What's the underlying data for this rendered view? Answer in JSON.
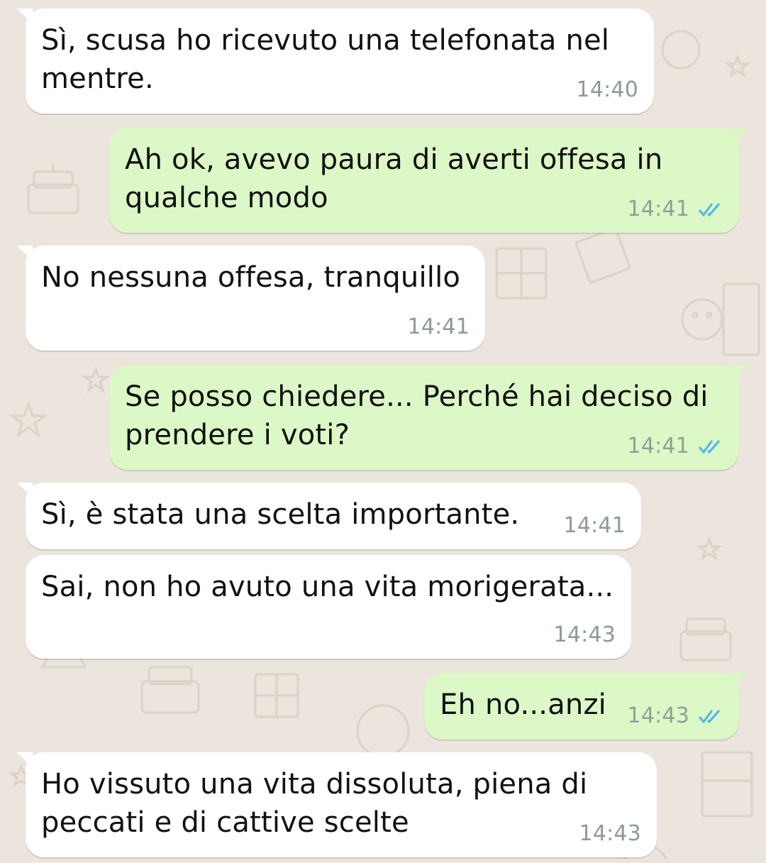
{
  "colors": {
    "background": "#ece5dd",
    "incoming_bubble": "#ffffff",
    "outgoing_bubble": "#dcf8c6",
    "read_ticks": "#4fb6ec",
    "timestamp": "#8c9a9a"
  },
  "messages": [
    {
      "direction": "in",
      "text": "Sì, scusa ho ricevuto una telefonata nel\nmentre.",
      "time": "14:40"
    },
    {
      "direction": "out",
      "text": "Ah ok, avevo paura di averti offesa in\nqualche modo",
      "time": "14:41",
      "status": "read-ticks-icon"
    },
    {
      "direction": "in",
      "text": "No nessuna offesa, tranquillo",
      "time": "14:41"
    },
    {
      "direction": "out",
      "text": "Se posso chiedere... Perché hai deciso di\nprendere i voti?",
      "time": "14:41",
      "status": "read-ticks-icon"
    },
    {
      "direction": "in",
      "text": "Sì, è stata una scelta importante.",
      "time": "14:41"
    },
    {
      "direction": "in",
      "text": "Sai, non ho avuto una vita morigerata...",
      "time": "14:43"
    },
    {
      "direction": "out",
      "text": "Eh no...anzi",
      "time": "14:43",
      "status": "read-ticks-icon"
    },
    {
      "direction": "in",
      "text": "Ho vissuto una vita dissoluta, piena di\npeccati e di cattive scelte",
      "time": "14:43"
    }
  ]
}
